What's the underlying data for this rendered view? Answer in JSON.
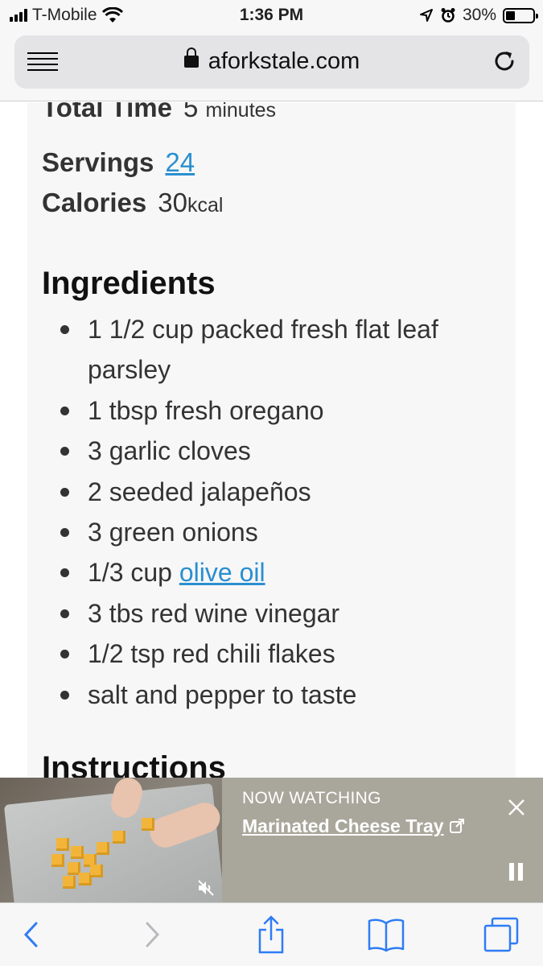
{
  "status_bar": {
    "carrier": "T-Mobile",
    "time": "1:36 PM",
    "battery": "30%",
    "battery_level": 0.3
  },
  "browser": {
    "url": "aforkstale.com"
  },
  "recipe": {
    "total_time_label": "Total Time",
    "total_time_value": "5",
    "total_time_unit": "minutes",
    "servings_label": "Servings",
    "servings_value": "24",
    "calories_label": "Calories",
    "calories_value": "30",
    "calories_unit": "kcal",
    "ingredients_title": "Ingredients",
    "ingredients": [
      "1 1/2 cup packed fresh flat leaf parsley",
      "1 tbsp fresh oregano",
      "3 garlic cloves",
      "2 seeded jalapeños",
      "3 green onions",
      "1/3 cup ",
      "3 tbs red wine vinegar",
      "1/2 tsp red chili flakes",
      "salt and pepper to taste"
    ],
    "olive_oil_link": "olive oil",
    "instructions_title": "Instructions"
  },
  "video": {
    "now_watching": "NOW WATCHING",
    "title": "Marinated Cheese Tray"
  },
  "colors": {
    "link": "#2a8fd0",
    "ios_blue": "#2f7cf6",
    "video_bar": "#a9a79b"
  },
  "icons": [
    "menu-icon",
    "lock-icon",
    "reload-icon",
    "mute-icon",
    "external-link-icon",
    "close-icon",
    "pause-icon",
    "back-icon",
    "forward-icon",
    "share-icon",
    "bookmarks-icon",
    "tabs-icon"
  ]
}
